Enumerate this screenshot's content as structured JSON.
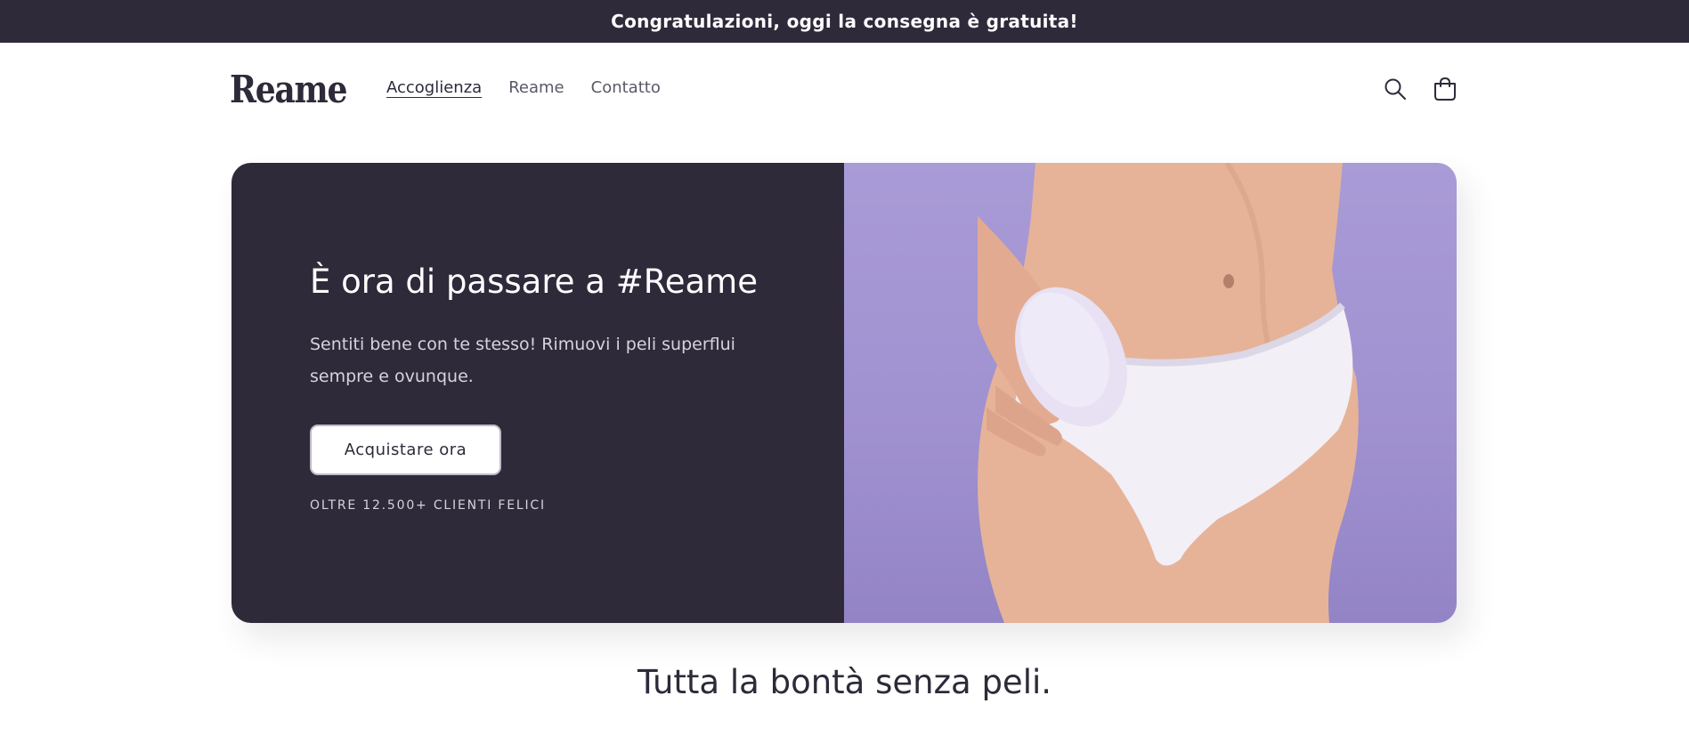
{
  "announcement": {
    "text": "Congratulazioni, oggi la consegna è gratuita!"
  },
  "header": {
    "logo": "Reame",
    "nav": [
      {
        "label": "Accoglienza",
        "active": true
      },
      {
        "label": "Reame",
        "active": false
      },
      {
        "label": "Contatto",
        "active": false
      }
    ],
    "icons": {
      "search": "search-icon",
      "cart": "cart-icon"
    }
  },
  "hero": {
    "title": "È ora di passare a #Reame",
    "subtitle": "Sentiti bene con te stesso! Rimuovi i peli superflui sempre e ovunque.",
    "cta_label": "Acquistare ora",
    "note": "OLTRE 12.500+ CLIENTI FELICI",
    "image": "product-model-photo"
  },
  "section": {
    "title": "Tutta la bontà senza peli."
  },
  "colors": {
    "brand_dark": "#2e2a3a",
    "hero_image_bg": "#a99bd6",
    "white": "#ffffff"
  }
}
